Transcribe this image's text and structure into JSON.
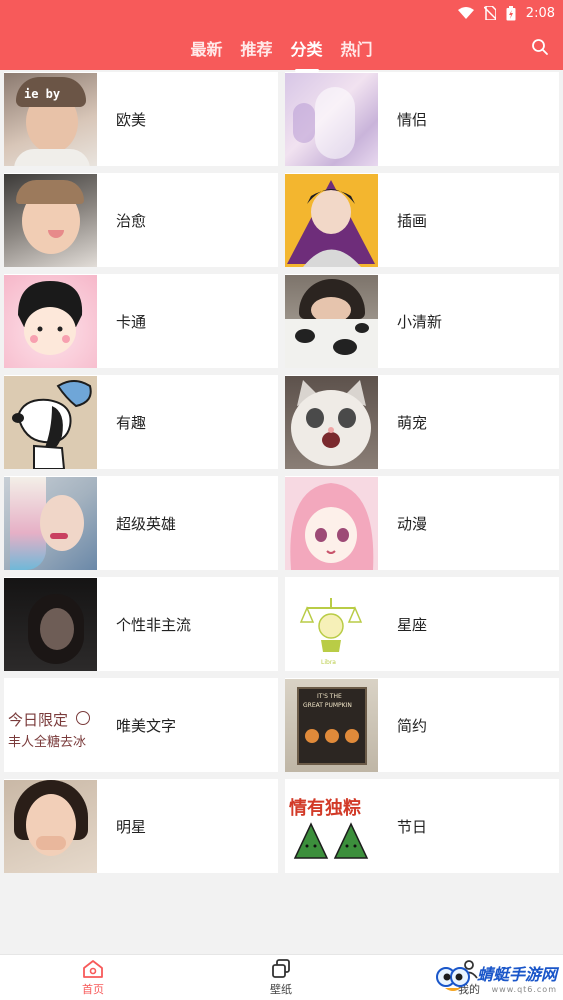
{
  "status": {
    "time": "2:08"
  },
  "tabs": [
    {
      "label": "最新"
    },
    {
      "label": "推荐"
    },
    {
      "label": "分类"
    },
    {
      "label": "热门"
    }
  ],
  "categories": [
    {
      "label": "欧美",
      "thumb": "portrait"
    },
    {
      "label": "情侣",
      "thumb": "pastel"
    },
    {
      "label": "治愈",
      "thumb": "child"
    },
    {
      "label": "插画",
      "thumb": "anime-boy"
    },
    {
      "label": "卡通",
      "thumb": "cartoon"
    },
    {
      "label": "小清新",
      "thumb": "girl-covered"
    },
    {
      "label": "有趣",
      "thumb": "snoopy"
    },
    {
      "label": "萌宠",
      "thumb": "cat"
    },
    {
      "label": "超级英雄",
      "thumb": "colorful-girl"
    },
    {
      "label": "动漫",
      "thumb": "anime-girl"
    },
    {
      "label": "个性非主流",
      "thumb": "dark-girl"
    },
    {
      "label": "星座",
      "thumb": "libra"
    },
    {
      "label": "唯美文字",
      "thumb": "text-art"
    },
    {
      "label": "简约",
      "thumb": "poster"
    },
    {
      "label": "明星",
      "thumb": "star-girl"
    },
    {
      "label": "节日",
      "thumb": "zongzi"
    }
  ],
  "thumb_texts": {
    "portrait": "ie by",
    "text_art_line1": "今日限定",
    "text_art_line2": "丰人全糖去冰",
    "poster_line1": "IT'S THE",
    "poster_line2": "GREAT PUMPKIN",
    "zongzi": "情有独粽"
  },
  "bottom_nav": [
    {
      "label": "首页",
      "icon": "home-icon"
    },
    {
      "label": "壁纸",
      "icon": "wallpaper-icon"
    },
    {
      "label": "我的",
      "icon": "profile-icon"
    }
  ],
  "watermark": {
    "name": "蜻蜓手游网",
    "url": "www.qt6.com"
  },
  "colors": {
    "accent": "#f75a5a",
    "tab_inactive": "#ffe9e9",
    "watermark": "#1a56c9"
  }
}
